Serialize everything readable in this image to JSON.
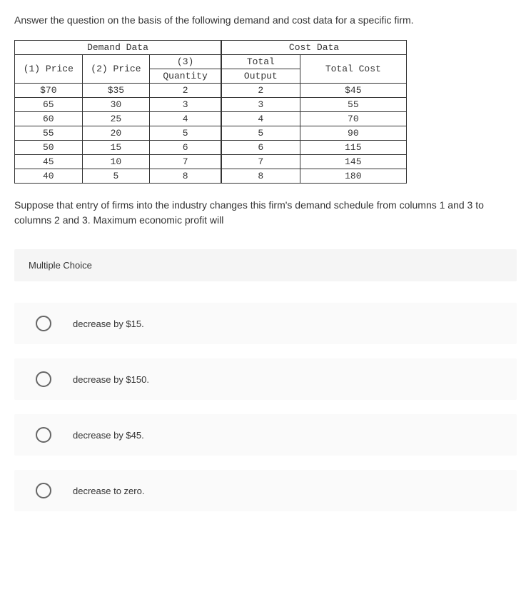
{
  "question": "Answer the question on the basis of the following demand and cost data for a specific firm.",
  "demand_header": "Demand Data",
  "cost_header": "Cost Data",
  "columns": {
    "price1": "(1) Price",
    "price2": "(2) Price",
    "qty_line1": "(3)",
    "qty_line2": "Quantity",
    "output_line1": "Total",
    "output_line2": "Output",
    "total_cost": "Total Cost"
  },
  "rows": [
    {
      "p1": "$70",
      "p2": "$35",
      "q": "2",
      "out": "2",
      "cost": "$45"
    },
    {
      "p1": "65",
      "p2": "30",
      "q": "3",
      "out": "3",
      "cost": "55"
    },
    {
      "p1": "60",
      "p2": "25",
      "q": "4",
      "out": "4",
      "cost": "70"
    },
    {
      "p1": "55",
      "p2": "20",
      "q": "5",
      "out": "5",
      "cost": "90"
    },
    {
      "p1": "50",
      "p2": "15",
      "q": "6",
      "out": "6",
      "cost": "115"
    },
    {
      "p1": "45",
      "p2": "10",
      "q": "7",
      "out": "7",
      "cost": "145"
    },
    {
      "p1": "40",
      "p2": "5",
      "q": "8",
      "out": "8",
      "cost": "180"
    }
  ],
  "follow_up": "Suppose that entry of firms into the industry changes this firm's demand schedule from columns 1 and 3 to columns 2 and 3. Maximum economic profit will",
  "mc_label": "Multiple Choice",
  "options": [
    "decrease by $15.",
    "decrease by $150.",
    "decrease by $45.",
    "decrease to zero."
  ]
}
